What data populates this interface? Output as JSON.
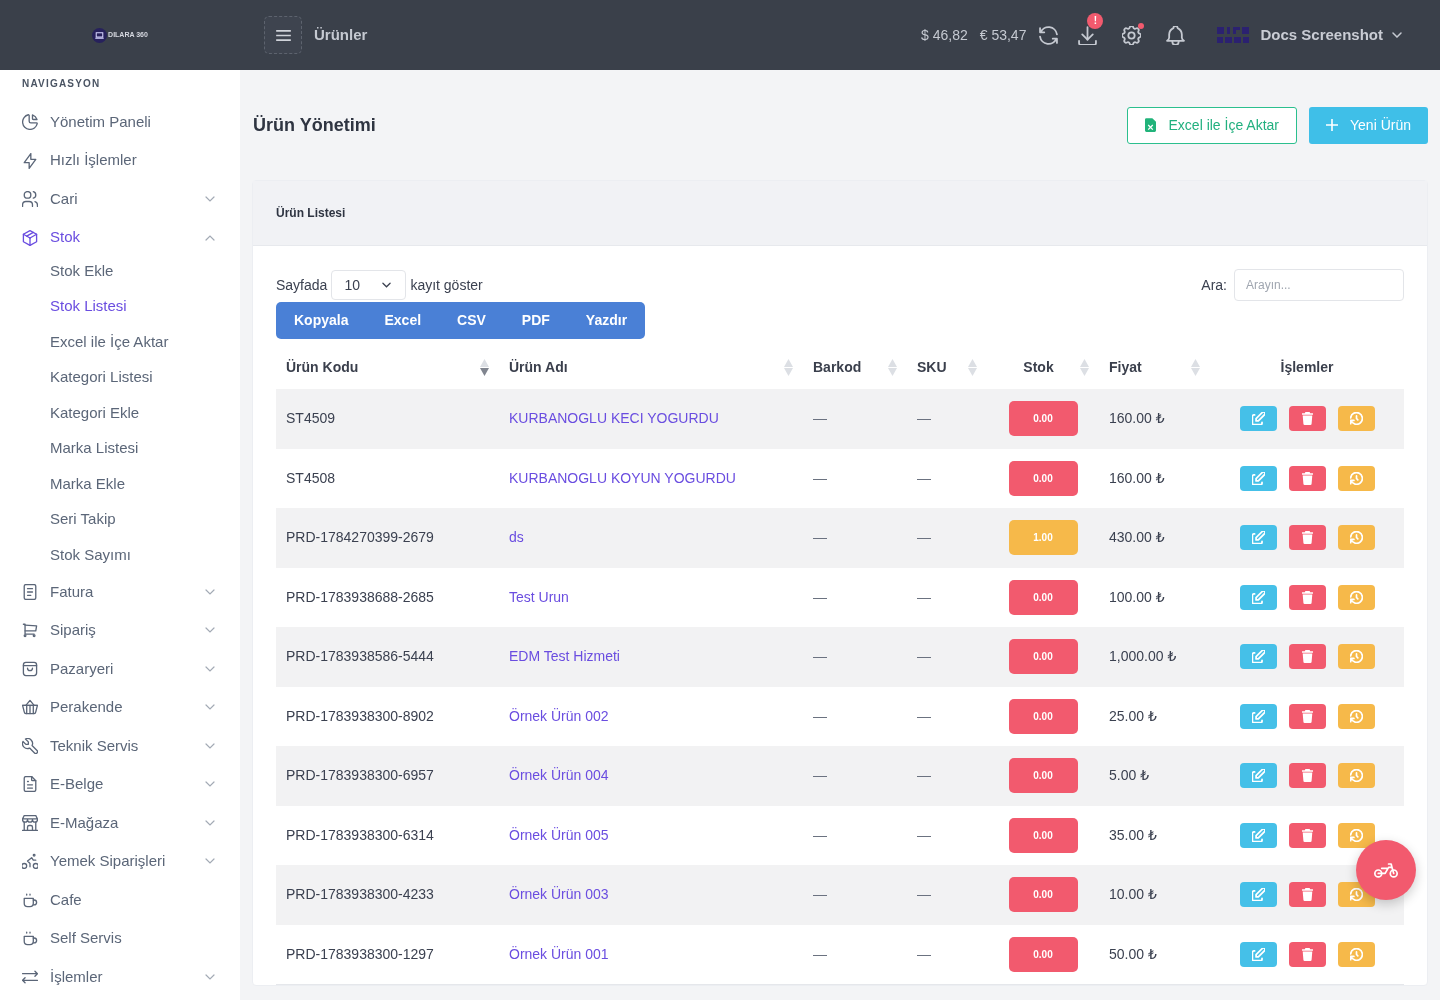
{
  "topbar": {
    "logo_text": "DILARA 360",
    "page_title": "Ürünler",
    "rates": [
      "$ 46,82",
      "€ 53,47"
    ],
    "download_badge": "!",
    "settings_alert": true,
    "user_name": "Docs Screenshot"
  },
  "sidebar": {
    "heading": "NAVIGASYON",
    "items": [
      {
        "label": "Yönetim Paneli",
        "selected": false,
        "has_submenu": false
      },
      {
        "label": "Hızlı İşlemler",
        "selected": false,
        "has_submenu": false
      },
      {
        "label": "Cari",
        "selected": false,
        "has_submenu": true,
        "expanded": false
      },
      {
        "label": "Stok",
        "selected": true,
        "has_submenu": true,
        "expanded": true,
        "children": [
          {
            "label": "Stok Ekle",
            "selected": false
          },
          {
            "label": "Stok Listesi",
            "selected": true
          },
          {
            "label": "Excel ile İçe Aktar",
            "selected": false
          },
          {
            "label": "Kategori Listesi",
            "selected": false
          },
          {
            "label": "Kategori Ekle",
            "selected": false
          },
          {
            "label": "Marka Listesi",
            "selected": false
          },
          {
            "label": "Marka Ekle",
            "selected": false
          },
          {
            "label": "Seri Takip",
            "selected": false
          },
          {
            "label": "Stok Sayımı",
            "selected": false
          }
        ]
      },
      {
        "label": "Fatura",
        "selected": false,
        "has_submenu": true,
        "expanded": false
      },
      {
        "label": "Sipariş",
        "selected": false,
        "has_submenu": true,
        "expanded": false
      },
      {
        "label": "Pazaryeri",
        "selected": false,
        "has_submenu": true,
        "expanded": false
      },
      {
        "label": "Perakende",
        "selected": false,
        "has_submenu": true,
        "expanded": false
      },
      {
        "label": "Teknik Servis",
        "selected": false,
        "has_submenu": true,
        "expanded": false
      },
      {
        "label": "E-Belge",
        "selected": false,
        "has_submenu": true,
        "expanded": false
      },
      {
        "label": "E-Mağaza",
        "selected": false,
        "has_submenu": true,
        "expanded": false
      },
      {
        "label": "Yemek Siparişleri",
        "selected": false,
        "has_submenu": true,
        "expanded": false
      },
      {
        "label": "Cafe",
        "selected": false,
        "has_submenu": false
      },
      {
        "label": "Self Servis",
        "selected": false,
        "has_submenu": false
      },
      {
        "label": "İşlemler",
        "selected": false,
        "has_submenu": true,
        "expanded": false
      }
    ]
  },
  "page": {
    "title": "Ürün Yönetimi",
    "buttons": [
      {
        "label": "Excel ile İçe Aktar",
        "kind": "outline"
      },
      {
        "label": "Yeni Ürün",
        "kind": "primary"
      }
    ]
  },
  "card": {
    "title": "Ürün Listesi",
    "length_menu": {
      "before": "Sayfada",
      "value": "10",
      "after": "kayıt göster"
    },
    "search": {
      "label": "Ara:",
      "placeholder": "Arayın..."
    },
    "export_buttons": [
      "Kopyala",
      "Excel",
      "CSV",
      "PDF",
      "Yazdır"
    ],
    "table": {
      "columns": [
        {
          "label": "Ürün Kodu",
          "sortable": true,
          "sorted": true
        },
        {
          "label": "Ürün Adı",
          "sortable": true,
          "sorted": false
        },
        {
          "label": "Barkod",
          "sortable": true,
          "sorted": false
        },
        {
          "label": "SKU",
          "sortable": true,
          "sorted": false
        },
        {
          "label": "Stok",
          "sortable": true,
          "sorted": false
        },
        {
          "label": "Fiyat",
          "sortable": true,
          "sorted": false
        },
        {
          "label": "İşlemler",
          "sortable": false
        }
      ],
      "rows": [
        {
          "code": "ST4509",
          "name": "KURBANOGLU KECI YOGURDU",
          "barcode": "—",
          "sku": "—",
          "stock": "0.00",
          "color": "#f25a6e",
          "price": "160.00 ₺"
        },
        {
          "code": "ST4508",
          "name": "KURBANOGLU KOYUN YOGURDU",
          "barcode": "—",
          "sku": "—",
          "stock": "0.00",
          "color": "#f25a6e",
          "price": "160.00 ₺"
        },
        {
          "code": "PRD-1784270399-2679",
          "name": "ds",
          "barcode": "—",
          "sku": "—",
          "stock": "1.00",
          "color": "#f6b94a",
          "price": "430.00 ₺"
        },
        {
          "code": "PRD-1783938688-2685",
          "name": "Test Urun",
          "barcode": "—",
          "sku": "—",
          "stock": "0.00",
          "color": "#f25a6e",
          "price": "100.00 ₺"
        },
        {
          "code": "PRD-1783938586-5444",
          "name": "EDM Test Hizmeti",
          "barcode": "—",
          "sku": "—",
          "stock": "0.00",
          "color": "#f25a6e",
          "price": "1,000.00 ₺"
        },
        {
          "code": "PRD-1783938300-8902",
          "name": "Örnek Ürün 002",
          "barcode": "—",
          "sku": "—",
          "stock": "0.00",
          "color": "#f25a6e",
          "price": "25.00 ₺"
        },
        {
          "code": "PRD-1783938300-6957",
          "name": "Örnek Ürün 004",
          "barcode": "—",
          "sku": "—",
          "stock": "0.00",
          "color": "#f25a6e",
          "price": "5.00 ₺"
        },
        {
          "code": "PRD-1783938300-6314",
          "name": "Örnek Ürün 005",
          "barcode": "—",
          "sku": "—",
          "stock": "0.00",
          "color": "#f25a6e",
          "price": "35.00 ₺"
        },
        {
          "code": "PRD-1783938300-4233",
          "name": "Örnek Ürün 003",
          "barcode": "—",
          "sku": "—",
          "stock": "0.00",
          "color": "#f25a6e",
          "price": "10.00 ₺"
        },
        {
          "code": "PRD-1783938300-1297",
          "name": "Örnek Ürün 001",
          "barcode": "—",
          "sku": "—",
          "stock": "0.00",
          "color": "#f25a6e",
          "price": "50.00 ₺"
        }
      ]
    }
  }
}
